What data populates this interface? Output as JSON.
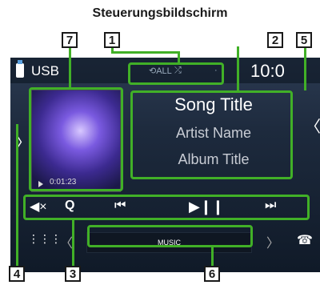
{
  "heading": "Steuerungsbildschirm",
  "source": {
    "label": "USB"
  },
  "clock": "10:0",
  "status": {
    "repeat": "⟲ALL",
    "shuffle": "⤮",
    "extra": "·"
  },
  "track": {
    "title": "Song Title",
    "artist": "Artist Name",
    "album": "Album Title",
    "elapsed": "0:01:23"
  },
  "controls": {
    "mute": "◀×",
    "search": "Q",
    "prev": "⏮",
    "play_pause": "▶❙❙",
    "next": "⏭"
  },
  "bottom": {
    "music_label": "MUSIC",
    "menu": "⋮⋮⋮",
    "phone": "☎"
  },
  "callouts": [
    "1",
    "2",
    "3",
    "4",
    "5",
    "6",
    "7"
  ],
  "colors": {
    "accent": "#41b027",
    "screen_bg": "#1d2a3d"
  }
}
